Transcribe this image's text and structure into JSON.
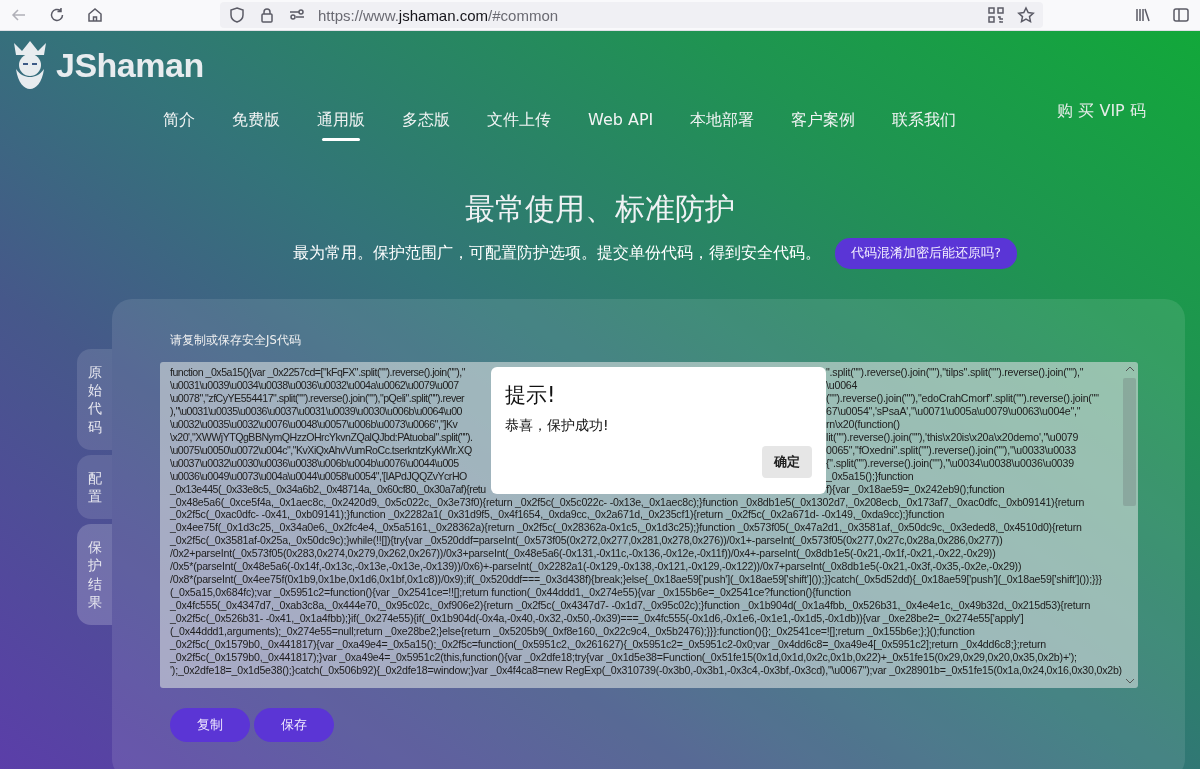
{
  "browser": {
    "url_scheme": "https://www.",
    "url_domain": "jshaman.com",
    "url_path": "/#common"
  },
  "logo": {
    "text": "JShaman"
  },
  "nav": [
    {
      "label": "简介",
      "selected": false
    },
    {
      "label": "免费版",
      "selected": false
    },
    {
      "label": "通用版",
      "selected": true
    },
    {
      "label": "多态版",
      "selected": false
    },
    {
      "label": "文件上传",
      "selected": false
    },
    {
      "label": "Web API",
      "selected": false
    },
    {
      "label": "本地部署",
      "selected": false
    },
    {
      "label": "客户案例",
      "selected": false
    },
    {
      "label": "联系我们",
      "selected": false
    }
  ],
  "buy_link": "购 买 VIP 码",
  "hero": {
    "title": "最常使用、标准防护",
    "subtitle": "最为常用。保护范围广，可配置防护选项。提交单份代码，得到安全代码。",
    "faq_button": "代码混淆加密后能还原吗?"
  },
  "side_tabs": [
    {
      "label": "原始代码",
      "selected": false
    },
    {
      "label": "配置",
      "selected": false
    },
    {
      "label": "保护结果",
      "selected": true
    }
  ],
  "output": {
    "label": "请复制或保存安全JS代码",
    "code_lines": [
      {
        "kind": "split",
        "left": "function _0x5a15(){var _0x2257cd=[\"kFqFX\".split(\"\").reverse().join(\"\"),\"",
        "right": "\".split(\"\").reverse().join(\"\"),\"tilps\".split(\"\").reverse().join(\"\"),\""
      },
      {
        "kind": "split",
        "left": "\\u0031\\u0039\\u0034\\u0038\\u0036\\u0032\\u004a\\u0062\\u0079\\u007",
        "right": "\\u0064"
      },
      {
        "kind": "split",
        "left": "\\u0078\",\"zfCyYE554417\".split(\"\").reverse().join(\"\"),\"pQeli\".split(\"\").rever",
        "right": "(\"\").reverse().join(\"\"),\"edoCrahCmorf\".split(\"\").reverse().join(\"\""
      },
      {
        "kind": "split",
        "left": "),\"\\u0031\\u0035\\u0036\\u0037\\u0031\\u0039\\u0030\\u006b\\u0064\\u00",
        "right": "67\\u0054\",'sPsaA',\"\\u0071\\u005a\\u0079\\u0063\\u004e\",\""
      },
      {
        "kind": "split",
        "left": "\\u0032\\u0035\\u0032\\u0076\\u0048\\u0057\\u006b\\u0073\\u0066\",\"]Kv",
        "right": "rn\\x20(function()"
      },
      {
        "kind": "split",
        "left": "\\x20',\"XWWjYTQgBBNymQHzzOHrcYkvnZQalQJbd:PAtuobal\".split(\"\").",
        "right": "lit(\"\").reverse().join(\"\"),'this\\x20is\\x20a\\x20demo',\"\\u0079"
      },
      {
        "kind": "split",
        "left": "\\u0075\\u0050\\u0072\\u004c\",\"KvXiQxAhvVumRoCc.tserkntzKykWlr.XQ",
        "right": "0065\",\"fOxedni\".split(\"\").reverse().join(\"\"),\"\\u0033\\u0033"
      },
      {
        "kind": "split",
        "left": "\\u0037\\u0032\\u0030\\u0036\\u0038\\u006b\\u004b\\u0076\\u0044\\u005",
        "right": "{\".split(\"\").reverse().join(\"\"),\"\\u0034\\u0038\\u0036\\u0039"
      },
      {
        "kind": "split",
        "left": "\\u0036\\u0049\\u0073\\u004a\\u0044\\u0058\\u0054\",'[IAPdJQQZvYcrHO",
        "right": "_0x5a15();}function"
      },
      {
        "kind": "split",
        "left": "_0x13e445(_0x33e8c5,_0x34a6b2,_0x48714a,_0x60cf80,_0x30a7af){retu",
        "right": "f){var _0x18ae59=_0x242eb9();function"
      },
      {
        "kind": "full",
        "text": "_0x48e5a6(_0xce5f4a,_0x1aec8c,_0x2420d9,_0x5c022c,_0x3e73f0){return _0x2f5c(_0x5c022c- -0x13e,_0x1aec8c);}function _0x8db1e5(_0x1302d7,_0x208ecb,_0x173af7,_0xac0dfc,_0xb09141){return"
      },
      {
        "kind": "full",
        "text": "_0x2f5c(_0xac0dfc- -0x41,_0xb09141);}function _0x2282a1(_0x31d9f5,_0x4f1654,_0xda9cc,_0x2a671d,_0x235cf1){return _0x2f5c(_0x2a671d- -0x149,_0xda9cc);}function"
      },
      {
        "kind": "full",
        "text": "_0x4ee75f(_0x1d3c25,_0x34a0e6,_0x2fc4e4,_0x5a5161,_0x28362a){return _0x2f5c(_0x28362a-0x1c5,_0x1d3c25);}function _0x573f05(_0x47a2d1,_0x3581af,_0x50dc9c,_0x3eded8,_0x4510d0){return"
      },
      {
        "kind": "full",
        "text": "_0x2f5c(_0x3581af-0x25a,_0x50dc9c);}while(!![]){try{var _0x520ddf=parseInt(_0x573f05(0x272,0x277,0x281,0x278,0x276))/0x1+-parseInt(_0x573f05(0x277,0x27c,0x28a,0x286,0x277))"
      },
      {
        "kind": "full",
        "text": "/0x2+parseInt(_0x573f05(0x283,0x274,0x279,0x262,0x267))/0x3+parseInt(_0x48e5a6(-0x131,-0x11c,-0x136,-0x12e,-0x11f))/0x4+-parseInt(_0x8db1e5(-0x21,-0x1f,-0x21,-0x22,-0x29))"
      },
      {
        "kind": "full",
        "text": "/0x5*(parseInt(_0x48e5a6(-0x14f,-0x13c,-0x13e,-0x13e,-0x139))/0x6)+-parseInt(_0x2282a1(-0x129,-0x138,-0x121,-0x129,-0x122))/0x7+parseInt(_0x8db1e5(-0x21,-0x3f,-0x35,-0x2e,-0x29))"
      },
      {
        "kind": "full",
        "text": "/0x8*(parseInt(_0x4ee75f(0x1b9,0x1be,0x1d6,0x1bf,0x1c8))/0x9);if(_0x520ddf===_0x3d438f){break;}else{_0x18ae59['push'](_0x18ae59['shift']());}}catch(_0x5d52dd){_0x18ae59['push'](_0x18ae59['shift']());}}}"
      },
      {
        "kind": "full",
        "text": "(_0x5a15,0x684fc);var _0x5951c2=function(){var _0x2541ce=!![];return function(_0x44ddd1,_0x274e55){var _0x155b6e=_0x2541ce?function(){function"
      },
      {
        "kind": "full",
        "text": "_0x4fc555(_0x4347d7,_0xab3c8a,_0x444e70,_0x95c02c,_0xf906e2){return _0x2f5c(_0x4347d7- -0x1d7,_0x95c02c);}function _0x1b904d(_0x1a4fbb,_0x526b31,_0x4e4e1c,_0x49b32d,_0x215d53){return"
      },
      {
        "kind": "full",
        "text": "_0x2f5c(_0x526b31- -0x41,_0x1a4fbb);}if(_0x274e55){if(_0x1b904d(-0x4a,-0x40,-0x32,-0x50,-0x39)===_0x4fc555(-0x1d6,-0x1e6,-0x1e1,-0x1d5,-0x1db)){var _0xe28be2=_0x274e55['apply']"
      },
      {
        "kind": "full",
        "text": "(_0x44ddd1,arguments);_0x274e55=null;return _0xe28be2;}else{return _0x5205b9(_0xf8e160,_0x22c9c4,_0x5b2476);}}}:function(){};_0x2541ce=![];return _0x155b6e;};}();function"
      },
      {
        "kind": "full",
        "text": "_0x2f5c(_0x1579b0,_0x441817){var _0xa49e4=_0x5a15();_0x2f5c=function(_0x5951c2,_0x261627){_0x5951c2=_0x5951c2-0x0;var _0x4dd6c8=_0xa49e4[_0x5951c2];return _0x4dd6c8;};return"
      },
      {
        "kind": "full",
        "text": "_0x2f5c(_0x1579b0,_0x441817);}var _0xa49e4=_0x5951c2(this,function(){var _0x2dfe18;try{var _0x1d5e38=Function(_0x51fe15(0x1d,0x1d,0x2c,0x1b,0x22)+_0x51fe15(0x29,0x29,0x20,0x35,0x2b)+');"
      },
      {
        "kind": "full",
        "text": "');_0x2dfe18=_0x1d5e38();}catch(_0x506b92){_0x2dfe18=window;}var _0x4f4ca8=new RegExp(_0x310739(-0x3b0,-0x3b1,-0x3c4,-0x3bf,-0x3cd),\"\\u0067\");var _0x28901b=_0x51fe15(0x1a,0x24,0x16,0x30,0x2b)"
      }
    ],
    "buttons": [
      "复制",
      "保存"
    ]
  },
  "dialog": {
    "title": "提示!",
    "message": "恭喜，保护成功!",
    "ok_button": "确定"
  }
}
